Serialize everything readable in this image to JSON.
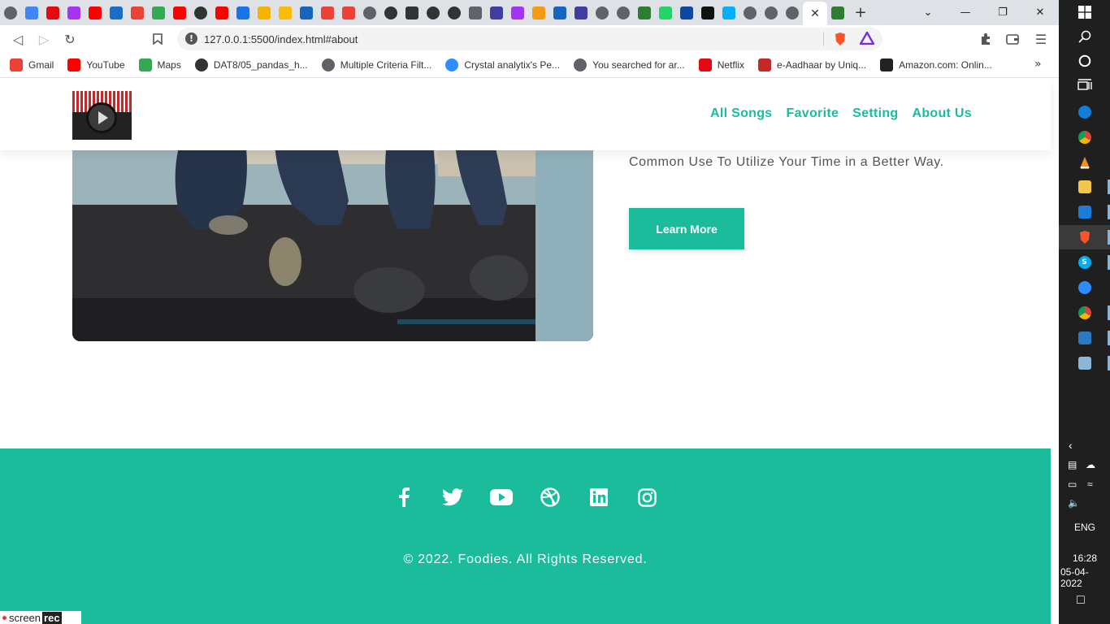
{
  "browser": {
    "url": "127.0.0.1:5500/index.html#about",
    "tabs": [
      {
        "icon": "globe-icon",
        "color": "#5f6368"
      },
      {
        "icon": "google-icon",
        "color": "#4285f4"
      },
      {
        "icon": "netflix-icon",
        "color": "#e50914"
      },
      {
        "icon": "udemy-icon",
        "color": "#a435f0"
      },
      {
        "icon": "youtube-icon",
        "color": "#ff0000"
      },
      {
        "icon": "notion-icon",
        "color": "#1b6ec2"
      },
      {
        "icon": "gmail-icon",
        "color": "#ea4335"
      },
      {
        "icon": "drive-icon",
        "color": "#34a853"
      },
      {
        "icon": "youtube-icon",
        "color": "#ff0000"
      },
      {
        "icon": "github-icon",
        "color": "#333333"
      },
      {
        "icon": "youtube-icon",
        "color": "#ff0000"
      },
      {
        "icon": "app-icon",
        "color": "#1a73e8"
      },
      {
        "icon": "app-icon",
        "color": "#f4b400"
      },
      {
        "icon": "app-icon",
        "color": "#fbbc04"
      },
      {
        "icon": "app-icon",
        "color": "#1565c0"
      },
      {
        "icon": "gmail-icon",
        "color": "#ea4335"
      },
      {
        "icon": "gmail-icon",
        "color": "#ea4335"
      },
      {
        "icon": "globe-icon",
        "color": "#5f6368"
      },
      {
        "icon": "github-icon",
        "color": "#333333"
      },
      {
        "icon": "app-icon",
        "color": "#333333"
      },
      {
        "icon": "github-icon",
        "color": "#333333"
      },
      {
        "icon": "github-icon",
        "color": "#333333"
      },
      {
        "icon": "cloud-icon",
        "color": "#5f6368"
      },
      {
        "icon": "app-icon",
        "color": "#3f3d9e"
      },
      {
        "icon": "udemy-icon",
        "color": "#a435f0"
      },
      {
        "icon": "app-icon",
        "color": "#f39c12"
      },
      {
        "icon": "app-icon",
        "color": "#1565c0"
      },
      {
        "icon": "app-icon",
        "color": "#3f3d9e"
      },
      {
        "icon": "globe-icon",
        "color": "#5f6368"
      },
      {
        "icon": "globe-icon",
        "color": "#5f6368"
      },
      {
        "icon": "app-icon",
        "color": "#2e7d32"
      },
      {
        "icon": "whatsapp-icon",
        "color": "#25d366"
      },
      {
        "icon": "app-icon",
        "color": "#0d47a1"
      },
      {
        "icon": "codepen-icon",
        "color": "#111111"
      },
      {
        "icon": "app-icon",
        "color": "#00b0ff"
      },
      {
        "icon": "globe-icon",
        "color": "#5f6368"
      },
      {
        "icon": "globe-icon",
        "color": "#5f6368"
      },
      {
        "icon": "globe-icon",
        "color": "#5f6368"
      },
      {
        "icon": "app-icon",
        "color": "#2e7d32"
      }
    ],
    "bookmarks": [
      {
        "label": "Gmail",
        "icon": "gmail-icon",
        "color": "#ea4335"
      },
      {
        "label": "YouTube",
        "icon": "youtube-icon",
        "color": "#ff0000"
      },
      {
        "label": "Maps",
        "icon": "maps-icon",
        "color": "#34a853"
      },
      {
        "label": "DAT8/05_pandas_h...",
        "icon": "github-icon",
        "color": "#333333"
      },
      {
        "label": "Multiple Criteria Filt...",
        "icon": "globe-icon",
        "color": "#5f6368"
      },
      {
        "label": "Crystal analytix's Pe...",
        "icon": "zoom-icon",
        "color": "#2d8cff"
      },
      {
        "label": "You searched for ar...",
        "icon": "globe-icon",
        "color": "#5f6368"
      },
      {
        "label": "Netflix",
        "icon": "netflix-icon",
        "color": "#e50914"
      },
      {
        "label": "e-Aadhaar by Uniq...",
        "icon": "aadhaar-icon",
        "color": "#c62828"
      },
      {
        "label": "Amazon.com: Onlin...",
        "icon": "amazon-icon",
        "color": "#222222"
      }
    ]
  },
  "site": {
    "nav": [
      "All Songs",
      "Favorite",
      "Setting",
      "About Us"
    ],
    "about_text": "Common Use To Utilize Your Time in a Better Way.",
    "cta_label": "Learn More",
    "social": [
      "facebook-icon",
      "twitter-icon",
      "youtube-icon",
      "dribbble-icon",
      "linkedin-icon",
      "instagram-icon"
    ],
    "copyright": "© 2022. Foodies. All Rights Reserved.",
    "accent": "#1abc9c"
  },
  "watermark": {
    "brand": "screen",
    "brand_bold": "rec"
  },
  "taskbar": {
    "lang": "ENG",
    "time": "16:28",
    "date": "05-04-2022"
  }
}
